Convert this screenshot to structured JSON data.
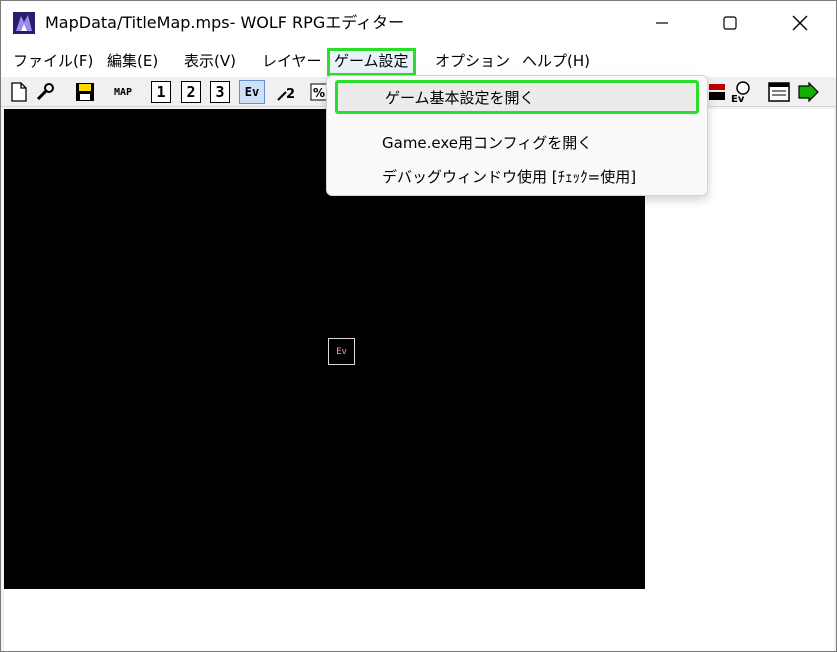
{
  "window": {
    "title": "MapData/TitleMap.mps- WOLF RPGエディター"
  },
  "menubar": {
    "items": [
      {
        "label": "ファイル(F)"
      },
      {
        "label": "編集(E)"
      },
      {
        "label": "表示(V)"
      },
      {
        "label": "レイヤー"
      },
      {
        "label": "ゲーム設定"
      },
      {
        "label": "オプション"
      },
      {
        "label": "ヘルプ(H)"
      }
    ]
  },
  "toolbar": {
    "map_label": "MAP",
    "layer1": "1",
    "layer2": "2",
    "layer3": "3",
    "ev_label": "Ev"
  },
  "dropdown": {
    "items": [
      {
        "label": "ゲーム基本設定を開く"
      },
      {
        "label": "Game.exe用コンフィグを開く"
      },
      {
        "label": "デバッグウィンドウ使用 [ﾁｪｯｸ=使用]"
      }
    ]
  },
  "canvas": {
    "event_label": "Ev"
  },
  "colors": {
    "highlight": "#2adf2a",
    "canvas_bg": "#000000"
  }
}
